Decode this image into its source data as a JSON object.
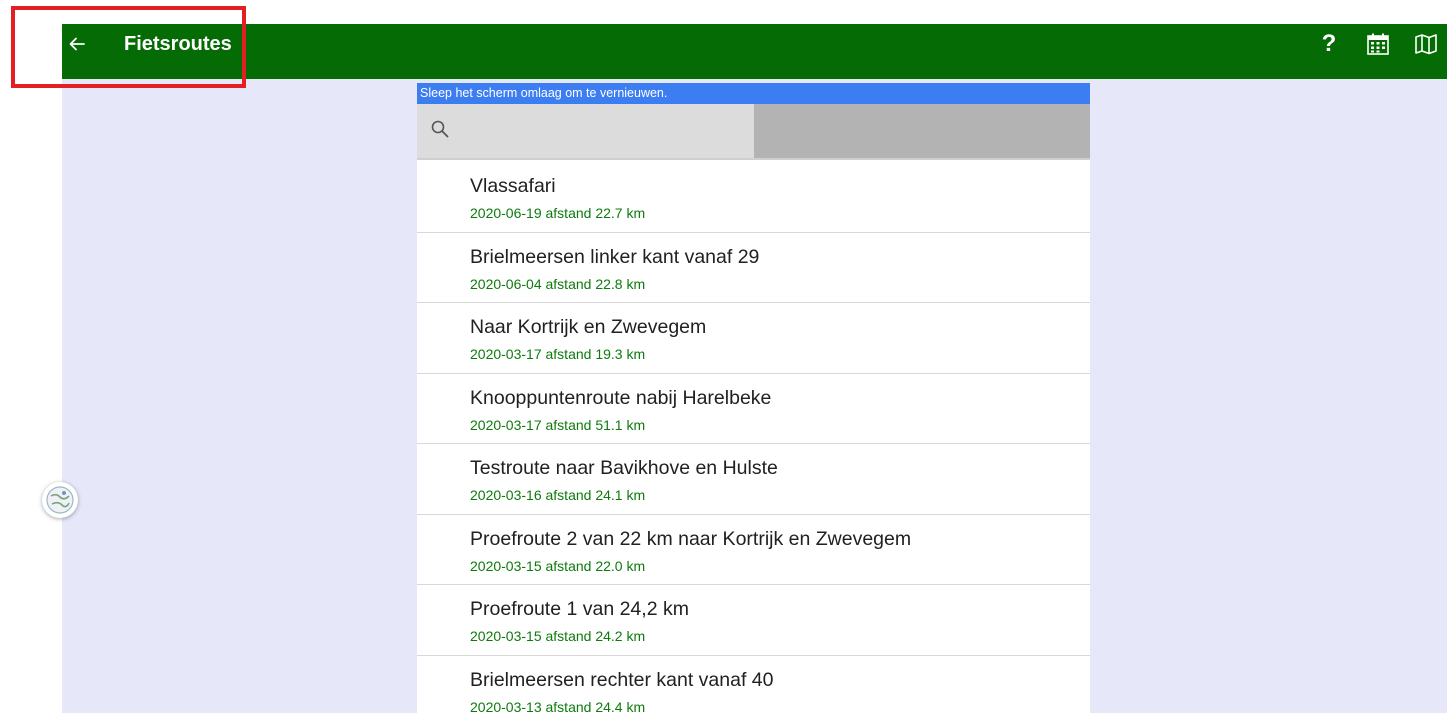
{
  "toolbar": {
    "title": "Fietsroutes",
    "help_label": "?",
    "back_icon": "arrow-left-icon",
    "calendar_icon": "calendar-icon",
    "map_icon": "map-icon",
    "background_color": "#056b05"
  },
  "banner": {
    "text": "Sleep het scherm omlaag om te vernieuwen.",
    "color": "#3c7df1"
  },
  "search": {
    "value": "",
    "placeholder": ""
  },
  "routes": [
    {
      "name": "Vlassafari",
      "meta": "2020-06-19 afstand 22.7 km"
    },
    {
      "name": "Brielmeersen linker kant vanaf 29",
      "meta": "2020-06-04 afstand 22.8 km"
    },
    {
      "name": "Naar Kortrijk en Zwevegem",
      "meta": "2020-03-17 afstand 19.3 km"
    },
    {
      "name": "Knooppuntenroute nabij Harelbeke",
      "meta": "2020-03-17 afstand 51.1 km"
    },
    {
      "name": "Testroute naar Bavikhove en Hulste",
      "meta": "2020-03-16 afstand 24.1 km"
    },
    {
      "name": "Proefroute 2 van 22 km naar Kortrijk en Zwevegem",
      "meta": "2020-03-15 afstand 22.0 km"
    },
    {
      "name": "Proefroute 1 van 24,2 km",
      "meta": "2020-03-15 afstand 24.2 km"
    },
    {
      "name": "Brielmeersen rechter kant vanaf 40",
      "meta": "2020-03-13 afstand 24.4 km"
    }
  ],
  "accent_colors": {
    "meta_text": "#0e7a0e",
    "page_background": "#e6e7f9",
    "highlight_box": "#e31e24"
  }
}
